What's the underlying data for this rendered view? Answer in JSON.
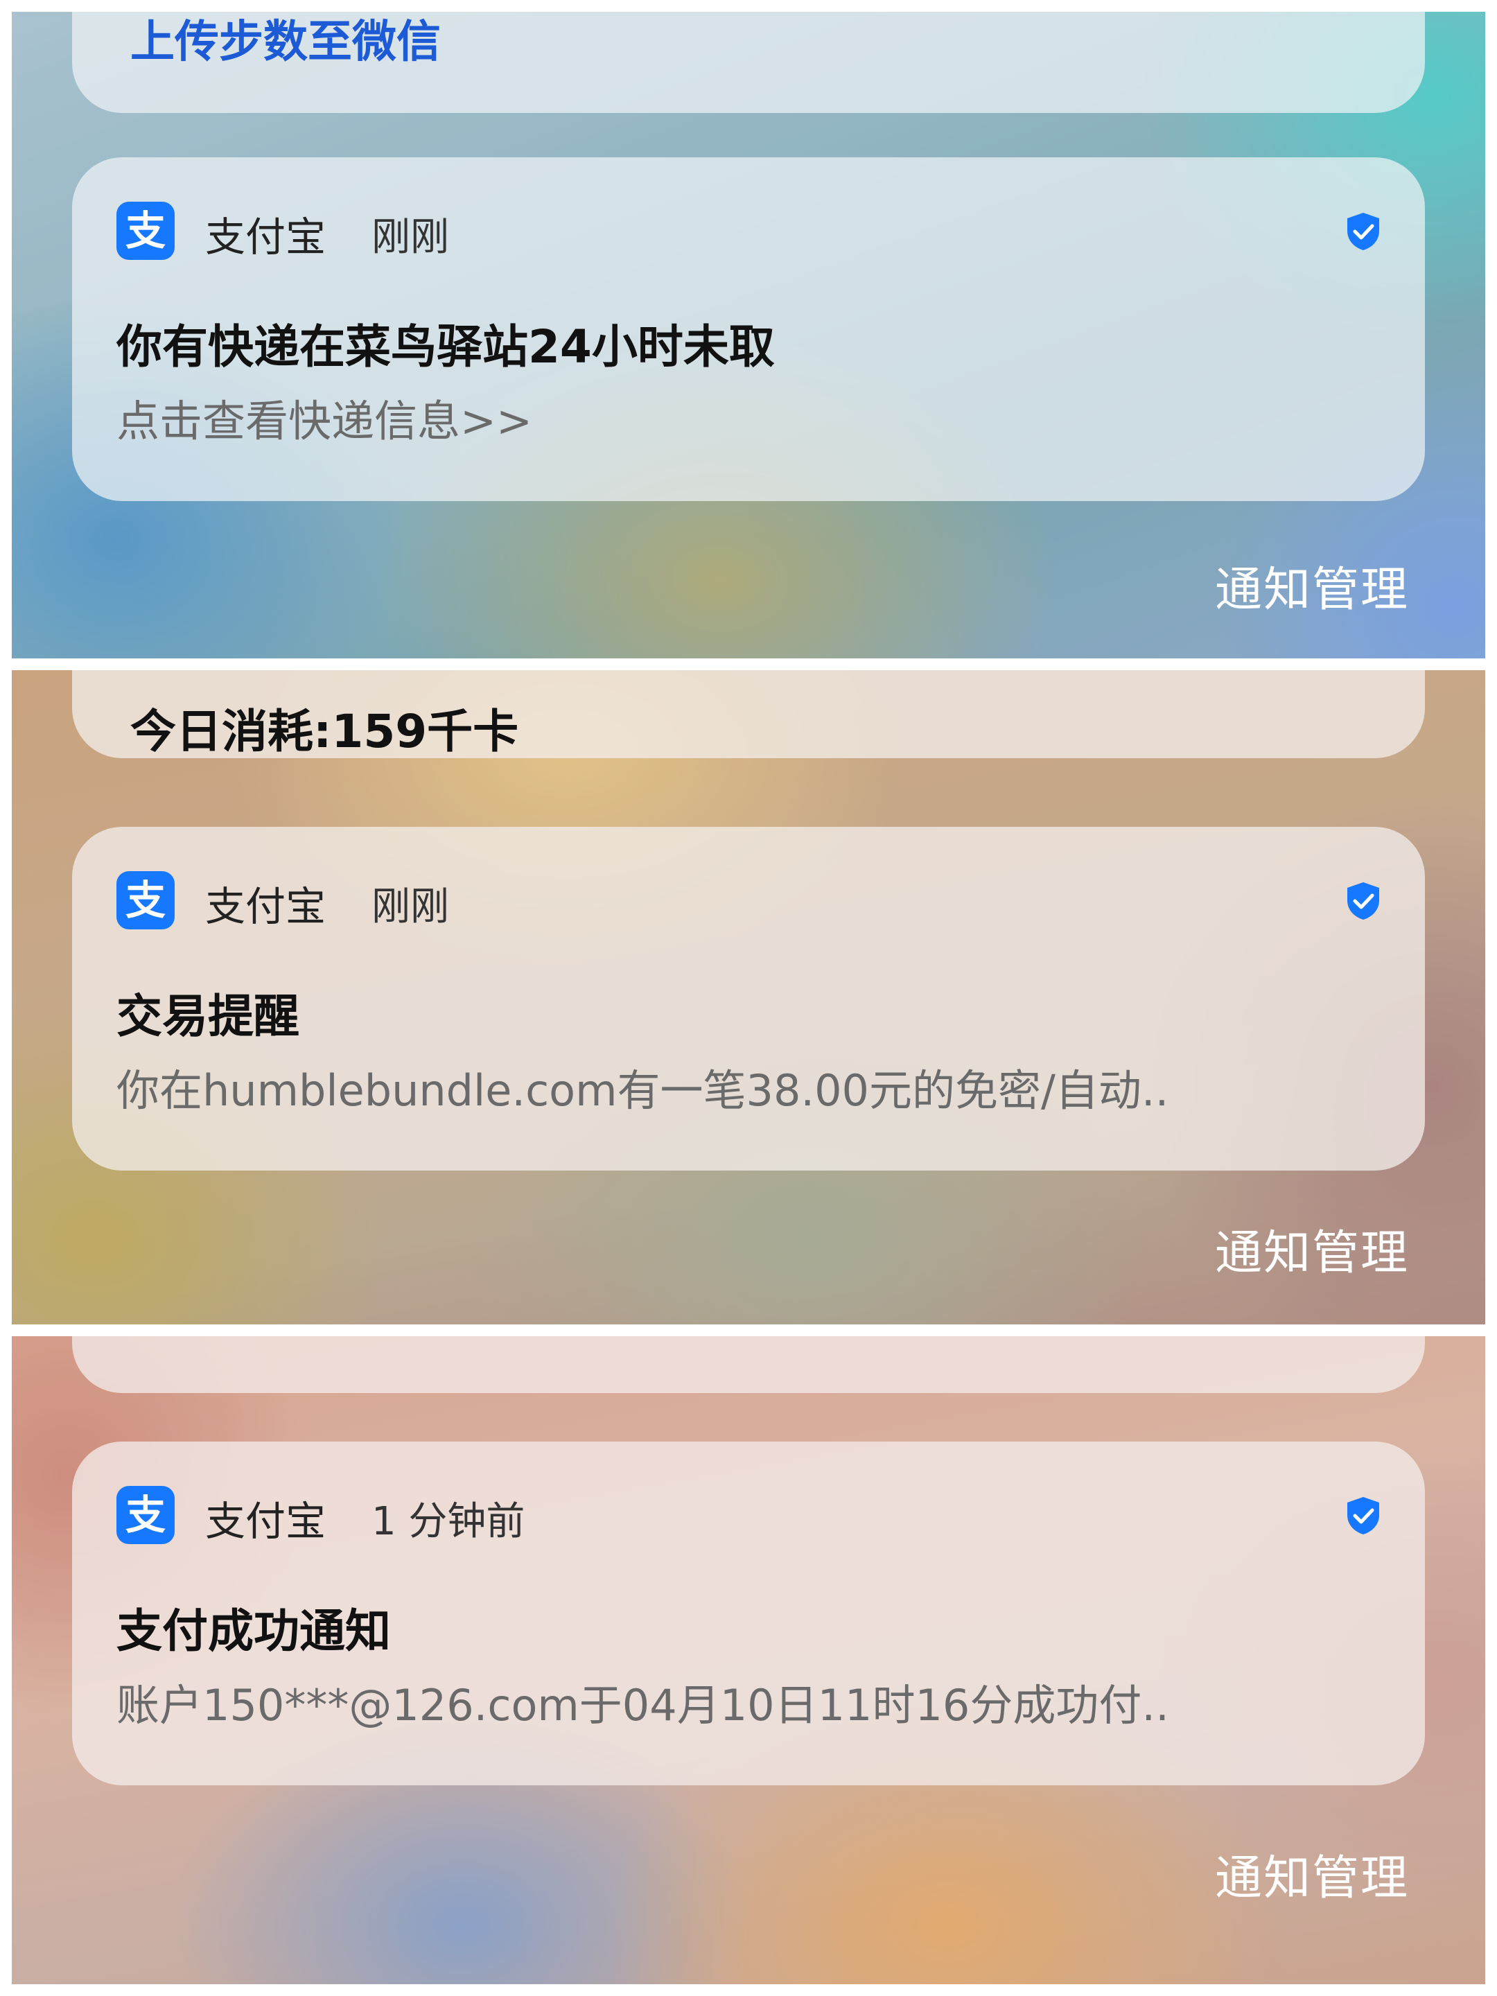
{
  "panels": [
    {
      "partial_card_text": "上传步数至微信",
      "notification": {
        "app_icon_glyph": "支",
        "app_name": "支付宝",
        "time": "刚刚",
        "title": "你有快递在菜鸟驿站24小时未取",
        "body": "点击查看快递信息>>"
      },
      "manage_label": "通知管理"
    },
    {
      "partial_card_text": "今日消耗:159千卡",
      "notification": {
        "app_icon_glyph": "支",
        "app_name": "支付宝",
        "time": "刚刚",
        "title": "交易提醒",
        "body": "你在humblebundle.com有一笔38.00元的免密/自动.."
      },
      "manage_label": "通知管理"
    },
    {
      "partial_card_text": "",
      "notification": {
        "app_icon_glyph": "支",
        "app_name": "支付宝",
        "time": "1 分钟前",
        "title": "支付成功通知",
        "body": "账户150***@126.com于04月10日11时16分成功付.."
      },
      "manage_label": "通知管理"
    }
  ],
  "icons": {
    "app": "alipay-icon",
    "verified": "verified-shield-icon"
  },
  "colors": {
    "alipay_blue": "#1677ff",
    "link_blue": "#1d5bd6"
  }
}
